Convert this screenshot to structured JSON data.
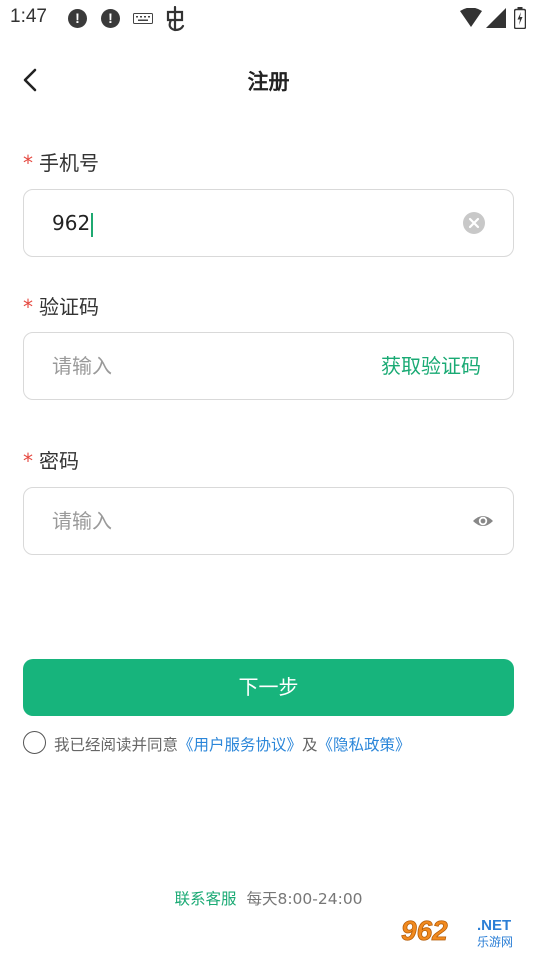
{
  "status_bar": {
    "time": "1:47",
    "alert_glyph": "!"
  },
  "header": {
    "title": "注册"
  },
  "phone": {
    "label": "手机号",
    "required_mark": "*",
    "value": "962"
  },
  "code": {
    "label": "验证码",
    "required_mark": "*",
    "placeholder": "请输入",
    "get_code_label": "获取验证码"
  },
  "password": {
    "label": "密码",
    "required_mark": "*",
    "placeholder": "请输入"
  },
  "next_button": {
    "label": "下一步"
  },
  "agreement": {
    "prefix": "我已经阅读并同意",
    "user_agreement": "《用户服务协议》",
    "conjunction": "及",
    "privacy_policy": "《隐私政策》"
  },
  "footer": {
    "service_link": "联系客服",
    "hours": "每天8:00-24:00"
  },
  "watermark": {
    "text_main": "962",
    "text_net": ".NET",
    "text_sub": "乐游网"
  },
  "colors": {
    "accent_green": "#17b47c",
    "link_blue": "#2b86d9",
    "required_red": "#e5483f"
  }
}
